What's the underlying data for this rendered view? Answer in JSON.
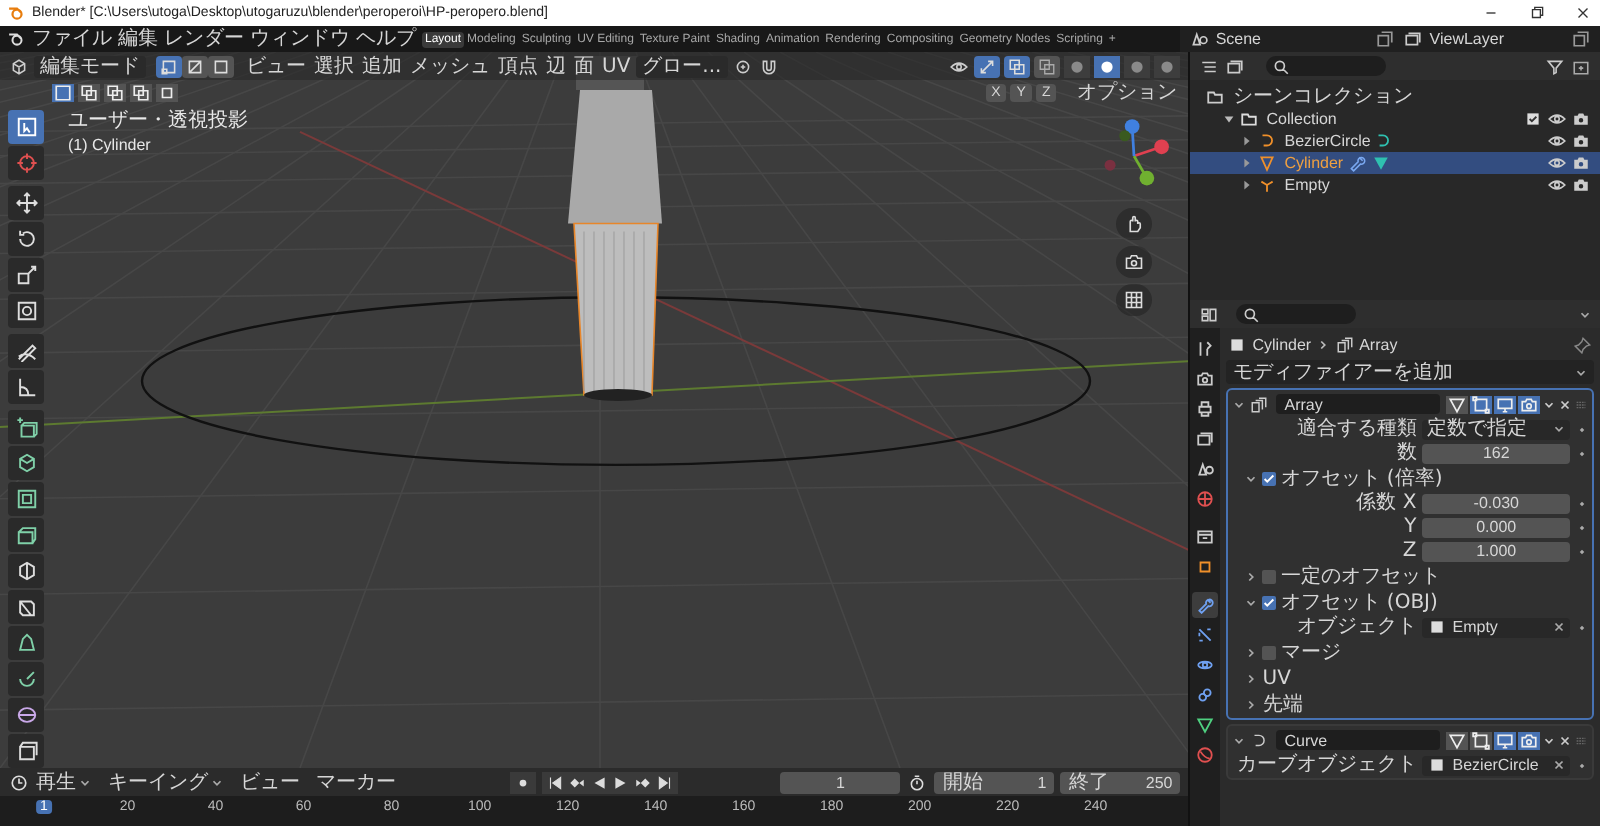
{
  "window": {
    "title": "Blender* [C:\\Users\\utoga\\Desktop\\utogaruzu\\blender\\peroperoi\\HP-peropero.blend]"
  },
  "menu": [
    "ファイル",
    "編集",
    "レンダー",
    "ウィンドウ",
    "ヘルプ"
  ],
  "workspaces": [
    {
      "label": "Layout",
      "selected": true
    },
    {
      "label": "Modeling",
      "selected": false
    },
    {
      "label": "Sculpting",
      "selected": false
    },
    {
      "label": "UV Editing",
      "selected": false
    },
    {
      "label": "Texture Paint",
      "selected": false
    },
    {
      "label": "Shading",
      "selected": false
    },
    {
      "label": "Animation",
      "selected": false
    },
    {
      "label": "Rendering",
      "selected": false
    },
    {
      "label": "Compositing",
      "selected": false
    },
    {
      "label": "Geometry Nodes",
      "selected": false
    },
    {
      "label": "Scripting",
      "selected": false
    }
  ],
  "add_workspace": "+",
  "scene": "Scene",
  "view_layer": "ViewLayer",
  "viewport": {
    "mode": "編集モード",
    "select_modes": [
      {
        "selected": true
      },
      {
        "selected": false
      },
      {
        "selected": false
      }
    ],
    "menus": [
      "ビュー",
      "選択",
      "追加",
      "メッシュ",
      "頂点",
      "辺",
      "面",
      "UV"
    ],
    "orientation": "グロー...",
    "gizmo": {
      "on": true
    },
    "overlay": {
      "on": true
    },
    "xray": {
      "on": false
    },
    "shading_modes": [
      {
        "selected": false
      },
      {
        "selected": true
      },
      {
        "selected": false
      },
      {
        "selected": false
      }
    ],
    "box_modes": [
      {
        "selected": true
      },
      {
        "selected": false
      },
      {
        "selected": false
      },
      {
        "selected": false
      },
      {
        "selected": false
      }
    ],
    "axes": [
      "X",
      "Y",
      "Z"
    ],
    "options": "オプション",
    "view_name": "ユーザー・透視投影",
    "object_name": "(1) Cylinder",
    "tools": [
      {
        "selected": true
      },
      {
        "selected": false
      },
      {
        "selected": false
      },
      {
        "selected": false
      },
      {
        "selected": false
      },
      {
        "selected": false
      },
      {
        "selected": false
      },
      {
        "selected": false
      },
      {
        "selected": false
      },
      {
        "selected": false
      },
      {
        "selected": false
      },
      {
        "selected": false
      },
      {
        "selected": false
      },
      {
        "selected": false
      },
      {
        "selected": false
      },
      {
        "selected": false
      },
      {
        "selected": false
      },
      {
        "selected": false
      }
    ]
  },
  "outliner": {
    "items": [
      {
        "label": "シーンコレクション",
        "kind": "scene",
        "selected": false,
        "children": [
          {
            "label": "Collection",
            "kind": "collection",
            "selected": false,
            "expanded": true,
            "children": [
              {
                "label": "BezierCircle",
                "kind": "curve",
                "selected": false
              },
              {
                "label": "Cylinder",
                "kind": "mesh",
                "selected": true
              },
              {
                "label": "Empty",
                "kind": "empty",
                "selected": false
              }
            ]
          }
        ]
      }
    ]
  },
  "properties": {
    "tabs": [
      {
        "selected": false
      },
      {
        "selected": false
      },
      {
        "selected": false
      },
      {
        "selected": false
      },
      {
        "selected": false
      },
      {
        "selected": false
      },
      {
        "selected": false
      },
      {
        "selected": false
      },
      {
        "selected": true
      },
      {
        "selected": false
      },
      {
        "selected": false
      },
      {
        "selected": false
      },
      {
        "selected": false
      },
      {
        "selected": false
      }
    ],
    "breadcrumb": [
      "Cylinder",
      "Array"
    ],
    "add_modifier": "モディファイアーを追加",
    "modifiers": [
      {
        "name": "Array",
        "active": true,
        "expanded": true,
        "toggles": [
          {
            "on": false
          },
          {
            "on": true
          },
          {
            "on": true
          },
          {
            "on": true
          }
        ],
        "rows": [
          {
            "kind": "dropdown",
            "label": "適合する種類",
            "value": "定数で指定"
          },
          {
            "kind": "number",
            "label": "数",
            "value": "162"
          },
          {
            "kind": "section",
            "label": "オフセット (倍率)",
            "checked": true,
            "expanded": true,
            "rows": [
              {
                "kind": "number",
                "label": "係数 X",
                "value": "-0.030"
              },
              {
                "kind": "number",
                "label": "Y",
                "value": "0.000"
              },
              {
                "kind": "number",
                "label": "Z",
                "value": "1.000"
              }
            ]
          },
          {
            "kind": "section",
            "label": "一定のオフセット",
            "checked": false,
            "expanded": false
          },
          {
            "kind": "section",
            "label": "オフセット (OBJ)",
            "checked": true,
            "expanded": true,
            "rows": [
              {
                "kind": "object",
                "label": "オブジェクト",
                "value": "Empty"
              }
            ]
          },
          {
            "kind": "section",
            "label": "マージ",
            "checked": false,
            "expanded": false
          },
          {
            "kind": "panel",
            "label": "UV",
            "expanded": false
          },
          {
            "kind": "panel",
            "label": "先端",
            "expanded": false
          }
        ]
      },
      {
        "name": "Curve",
        "active": false,
        "expanded": true,
        "toggles": [
          {
            "on": false
          },
          {
            "on": false
          },
          {
            "on": true
          },
          {
            "on": true
          }
        ],
        "rows": [
          {
            "kind": "object",
            "label": "カーブオブジェクト",
            "value": "BezierCircle"
          }
        ]
      }
    ]
  },
  "timeline": {
    "menus": [
      {
        "label": "再生",
        "dropdown": true
      },
      {
        "label": "キーイング",
        "dropdown": true
      },
      {
        "label": "ビュー",
        "dropdown": false
      },
      {
        "label": "マーカー",
        "dropdown": false
      }
    ],
    "current_frame": "1",
    "start_label": "開始",
    "start": "1",
    "end_label": "終了",
    "end": "250",
    "ticks": [
      {
        "label": "1",
        "selected": true
      },
      {
        "label": "20",
        "selected": false
      },
      {
        "label": "40",
        "selected": false
      },
      {
        "label": "60",
        "selected": false
      },
      {
        "label": "80",
        "selected": false
      },
      {
        "label": "100",
        "selected": false
      },
      {
        "label": "120",
        "selected": false
      },
      {
        "label": "140",
        "selected": false
      },
      {
        "label": "160",
        "selected": false
      },
      {
        "label": "180",
        "selected": false
      },
      {
        "label": "200",
        "selected": false
      },
      {
        "label": "220",
        "selected": false
      },
      {
        "label": "240",
        "selected": false
      }
    ]
  }
}
